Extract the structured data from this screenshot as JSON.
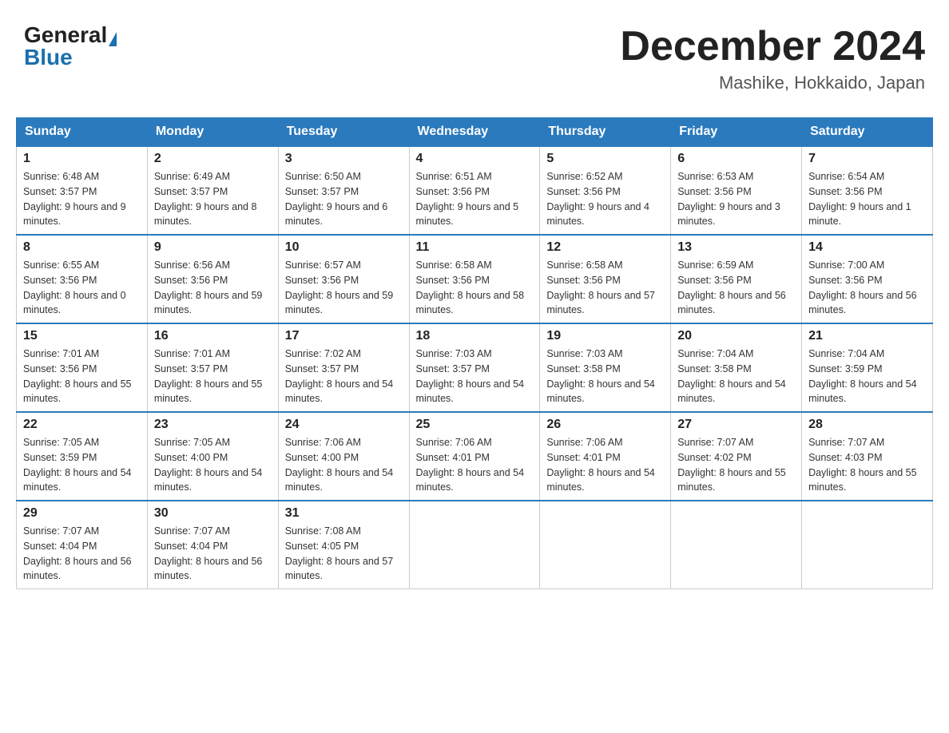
{
  "header": {
    "logo_general": "General",
    "logo_blue": "Blue",
    "month_title": "December 2024",
    "location": "Mashike, Hokkaido, Japan"
  },
  "days_of_week": [
    "Sunday",
    "Monday",
    "Tuesday",
    "Wednesday",
    "Thursday",
    "Friday",
    "Saturday"
  ],
  "weeks": [
    [
      {
        "day": "1",
        "sunrise": "6:48 AM",
        "sunset": "3:57 PM",
        "daylight": "9 hours and 9 minutes."
      },
      {
        "day": "2",
        "sunrise": "6:49 AM",
        "sunset": "3:57 PM",
        "daylight": "9 hours and 8 minutes."
      },
      {
        "day": "3",
        "sunrise": "6:50 AM",
        "sunset": "3:57 PM",
        "daylight": "9 hours and 6 minutes."
      },
      {
        "day": "4",
        "sunrise": "6:51 AM",
        "sunset": "3:56 PM",
        "daylight": "9 hours and 5 minutes."
      },
      {
        "day": "5",
        "sunrise": "6:52 AM",
        "sunset": "3:56 PM",
        "daylight": "9 hours and 4 minutes."
      },
      {
        "day": "6",
        "sunrise": "6:53 AM",
        "sunset": "3:56 PM",
        "daylight": "9 hours and 3 minutes."
      },
      {
        "day": "7",
        "sunrise": "6:54 AM",
        "sunset": "3:56 PM",
        "daylight": "9 hours and 1 minute."
      }
    ],
    [
      {
        "day": "8",
        "sunrise": "6:55 AM",
        "sunset": "3:56 PM",
        "daylight": "8 hours and 0 minutes."
      },
      {
        "day": "9",
        "sunrise": "6:56 AM",
        "sunset": "3:56 PM",
        "daylight": "8 hours and 59 minutes."
      },
      {
        "day": "10",
        "sunrise": "6:57 AM",
        "sunset": "3:56 PM",
        "daylight": "8 hours and 59 minutes."
      },
      {
        "day": "11",
        "sunrise": "6:58 AM",
        "sunset": "3:56 PM",
        "daylight": "8 hours and 58 minutes."
      },
      {
        "day": "12",
        "sunrise": "6:58 AM",
        "sunset": "3:56 PM",
        "daylight": "8 hours and 57 minutes."
      },
      {
        "day": "13",
        "sunrise": "6:59 AM",
        "sunset": "3:56 PM",
        "daylight": "8 hours and 56 minutes."
      },
      {
        "day": "14",
        "sunrise": "7:00 AM",
        "sunset": "3:56 PM",
        "daylight": "8 hours and 56 minutes."
      }
    ],
    [
      {
        "day": "15",
        "sunrise": "7:01 AM",
        "sunset": "3:56 PM",
        "daylight": "8 hours and 55 minutes."
      },
      {
        "day": "16",
        "sunrise": "7:01 AM",
        "sunset": "3:57 PM",
        "daylight": "8 hours and 55 minutes."
      },
      {
        "day": "17",
        "sunrise": "7:02 AM",
        "sunset": "3:57 PM",
        "daylight": "8 hours and 54 minutes."
      },
      {
        "day": "18",
        "sunrise": "7:03 AM",
        "sunset": "3:57 PM",
        "daylight": "8 hours and 54 minutes."
      },
      {
        "day": "19",
        "sunrise": "7:03 AM",
        "sunset": "3:58 PM",
        "daylight": "8 hours and 54 minutes."
      },
      {
        "day": "20",
        "sunrise": "7:04 AM",
        "sunset": "3:58 PM",
        "daylight": "8 hours and 54 minutes."
      },
      {
        "day": "21",
        "sunrise": "7:04 AM",
        "sunset": "3:59 PM",
        "daylight": "8 hours and 54 minutes."
      }
    ],
    [
      {
        "day": "22",
        "sunrise": "7:05 AM",
        "sunset": "3:59 PM",
        "daylight": "8 hours and 54 minutes."
      },
      {
        "day": "23",
        "sunrise": "7:05 AM",
        "sunset": "4:00 PM",
        "daylight": "8 hours and 54 minutes."
      },
      {
        "day": "24",
        "sunrise": "7:06 AM",
        "sunset": "4:00 PM",
        "daylight": "8 hours and 54 minutes."
      },
      {
        "day": "25",
        "sunrise": "7:06 AM",
        "sunset": "4:01 PM",
        "daylight": "8 hours and 54 minutes."
      },
      {
        "day": "26",
        "sunrise": "7:06 AM",
        "sunset": "4:01 PM",
        "daylight": "8 hours and 54 minutes."
      },
      {
        "day": "27",
        "sunrise": "7:07 AM",
        "sunset": "4:02 PM",
        "daylight": "8 hours and 55 minutes."
      },
      {
        "day": "28",
        "sunrise": "7:07 AM",
        "sunset": "4:03 PM",
        "daylight": "8 hours and 55 minutes."
      }
    ],
    [
      {
        "day": "29",
        "sunrise": "7:07 AM",
        "sunset": "4:04 PM",
        "daylight": "8 hours and 56 minutes."
      },
      {
        "day": "30",
        "sunrise": "7:07 AM",
        "sunset": "4:04 PM",
        "daylight": "8 hours and 56 minutes."
      },
      {
        "day": "31",
        "sunrise": "7:08 AM",
        "sunset": "4:05 PM",
        "daylight": "8 hours and 57 minutes."
      },
      null,
      null,
      null,
      null
    ]
  ],
  "sunrise_label": "Sunrise:",
  "sunset_label": "Sunset:",
  "daylight_label": "Daylight:"
}
